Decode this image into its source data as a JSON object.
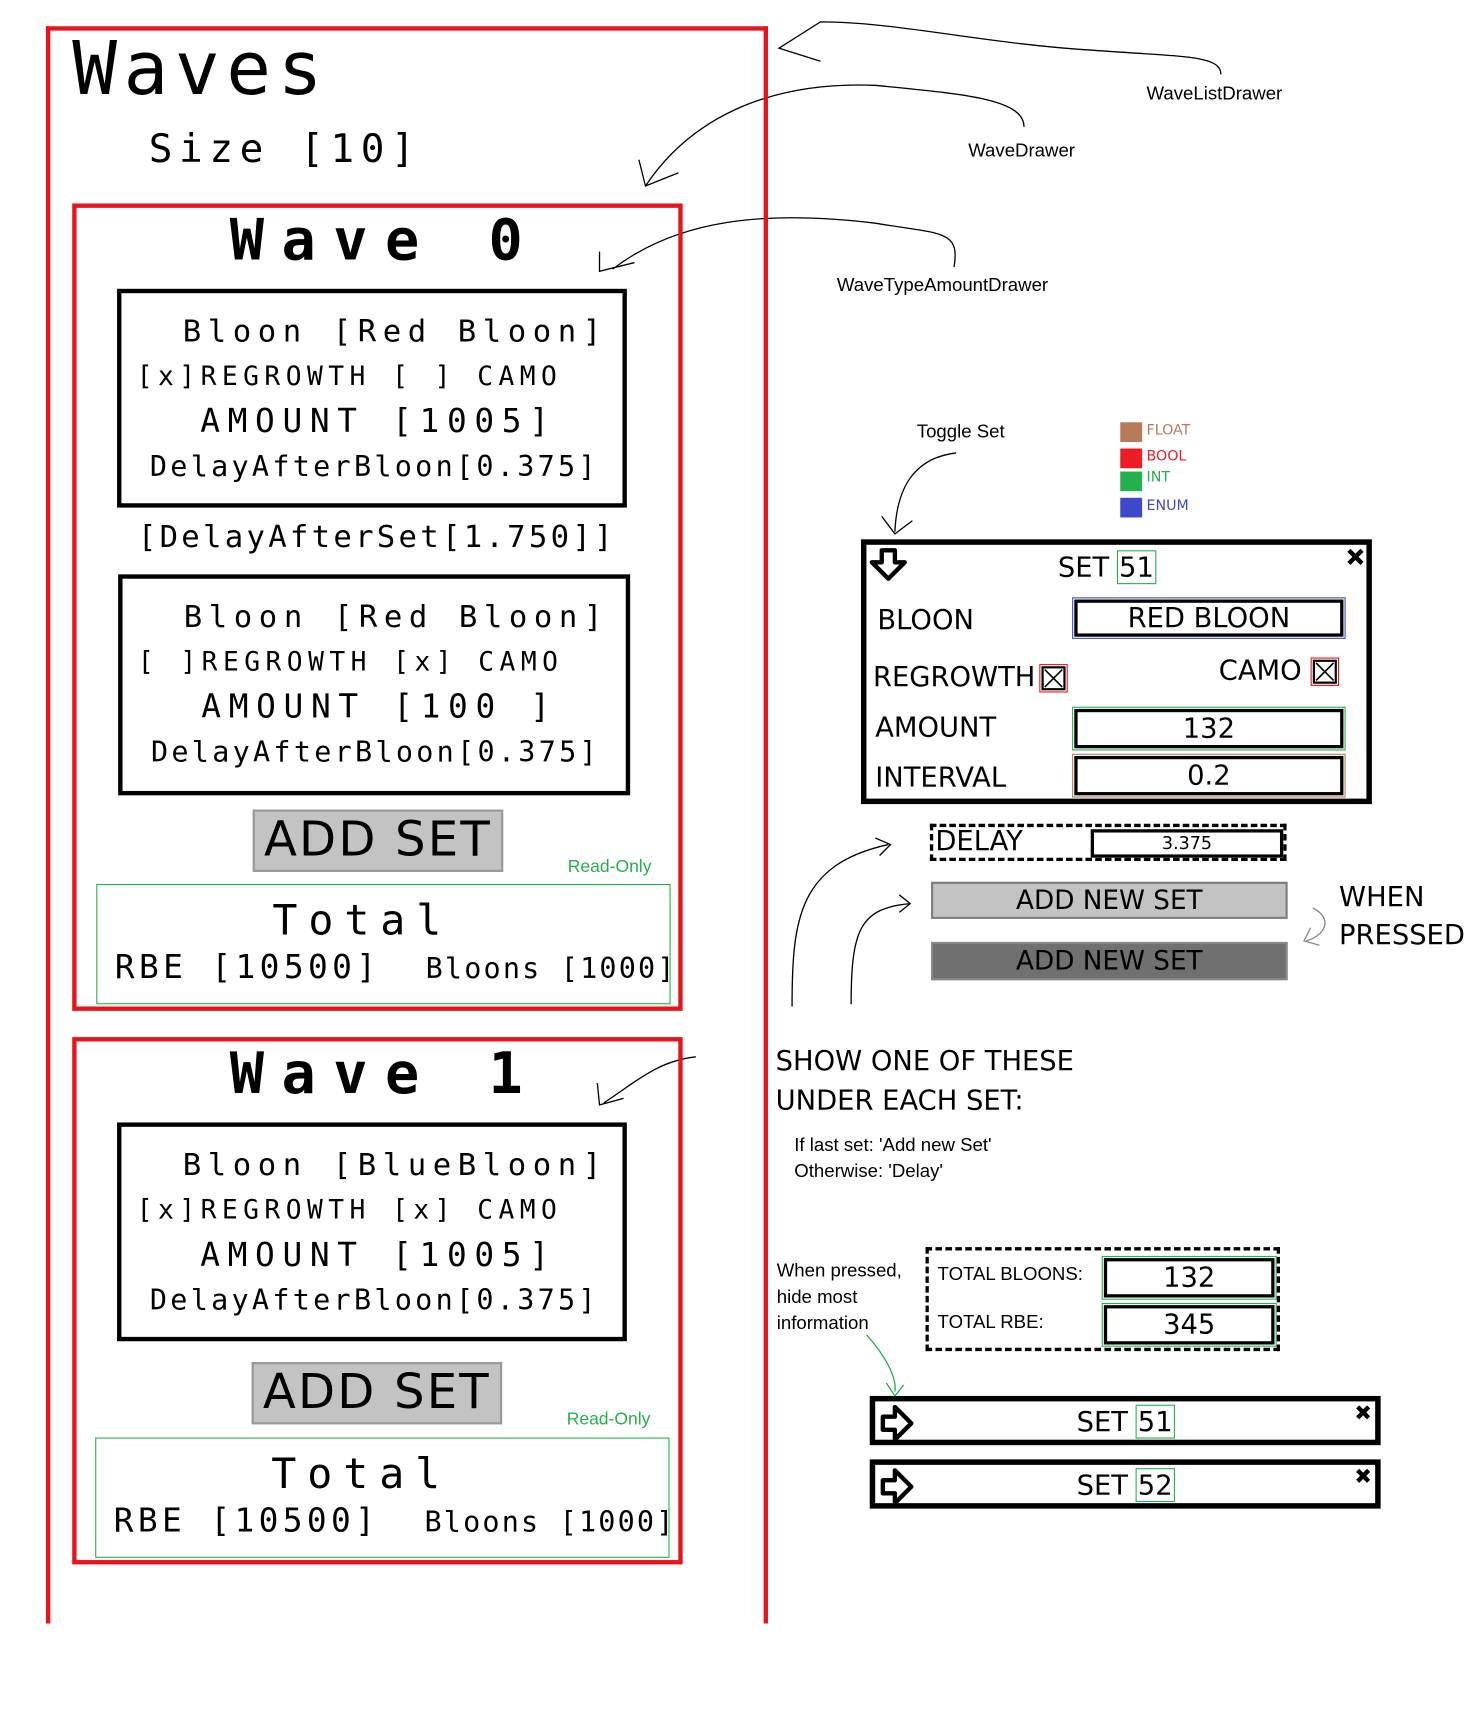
{
  "colors": {
    "wave_list_border": "#e8141c",
    "wave_border": "#e8141c",
    "float": "#b97a57",
    "bool": "#ed1c24",
    "int": "#22b14c",
    "enum": "#3f48cc",
    "readonly": "#22b14c"
  },
  "annotations": {
    "wave_list_drawer": "WaveListDrawer",
    "wave_drawer": "WaveDrawer",
    "wave_type_amount_drawer": "WaveTypeAmountDrawer",
    "toggle_set": "Toggle Set",
    "when_pressed_line1": "WHEN",
    "when_pressed_line2": "PRESSED",
    "show_one_line1": "SHOW ONE OF THESE",
    "show_one_line2": "UNDER EACH SET:",
    "if_last": "If last set: 'Add new Set'",
    "otherwise": "Otherwise: 'Delay'",
    "hide_line1": "When pressed,",
    "hide_line2": "hide most",
    "hide_line3": "information"
  },
  "legend": [
    {
      "label": "FLOAT",
      "color": "#b97a57"
    },
    {
      "label": "BOOL",
      "color": "#ed1c24"
    },
    {
      "label": "INT",
      "color": "#22b14c"
    },
    {
      "label": "ENUM",
      "color": "#3f48cc"
    }
  ],
  "sketch": {
    "title": "Waves",
    "size_label": "Size [10]",
    "waves": [
      {
        "title": "Wave 0",
        "sets": [
          {
            "bloon": "Bloon [Red Bloon]",
            "flags": "[x]REGROWTH [ ] CAMO",
            "amount": "AMOUNT [1005]",
            "delay": "DelayAfterBloon[0.375]"
          },
          {
            "bloon": "Bloon [Red Bloon]",
            "flags": "[ ]REGROWTH [x] CAMO",
            "amount": "AMOUNT [100 ]",
            "delay": "DelayAfterBloon[0.375]"
          }
        ],
        "delay_after_set": "[DelayAfterSet[1.750]]",
        "add_set": "ADD SET",
        "read_only": "Read-Only",
        "total_title": "Total",
        "total_rbe": "RBE [10500]",
        "total_bloons": "Bloons [1000]"
      },
      {
        "title": "Wave 1",
        "sets": [
          {
            "bloon": "Bloon [BlueBloon]",
            "flags": "[x]REGROWTH [x] CAMO",
            "amount": "AMOUNT [1005]",
            "delay": "DelayAfterBloon[0.375]"
          }
        ],
        "add_set": "ADD SET",
        "read_only": "Read-Only",
        "total_title": "Total",
        "total_rbe": "RBE [10500]",
        "total_bloons": "Bloons [1000]"
      }
    ]
  },
  "set_panel": {
    "title": "SET",
    "number": "51",
    "bloon_label": "BLOON",
    "bloon_value": "RED BLOON",
    "regrowth_label": "REGROWTH",
    "regrowth_checked": true,
    "camo_label": "CAMO",
    "camo_checked": true,
    "amount_label": "AMOUNT",
    "amount_value": "132",
    "interval_label": "INTERVAL",
    "interval_value": "0.2"
  },
  "delay_row": {
    "label": "DELAY",
    "value": "3.375"
  },
  "add_new_set": {
    "normal": "ADD NEW SET",
    "pressed": "ADD NEW SET"
  },
  "totals": {
    "bloons_label": "TOTAL BLOONS:",
    "bloons_value": "132",
    "rbe_label": "TOTAL RBE:",
    "rbe_value": "345"
  },
  "collapsed_sets": [
    {
      "title": "SET",
      "number": "51"
    },
    {
      "title": "SET",
      "number": "52"
    }
  ]
}
